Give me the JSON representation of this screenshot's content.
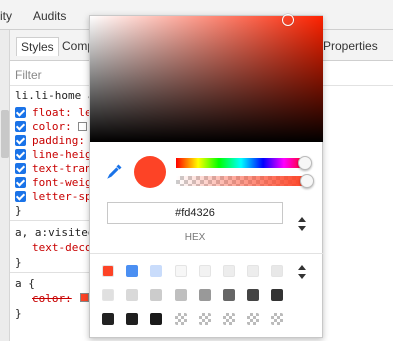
{
  "topbar": {
    "tab_prev": "ity",
    "tab_audits": "Audits"
  },
  "subtabs": {
    "styles": "Styles",
    "computed": "Comp",
    "properties": "Properties"
  },
  "filter": {
    "placeholder": "Filter"
  },
  "rules": [
    {
      "selector": "li.li-home a",
      "props": [
        "float: le",
        "color: ",
        "padding:",
        "line-heig",
        "text-tran",
        "font-weig",
        "letter-sp"
      ]
    },
    {
      "selector": "a, a:visited",
      "props": [
        "text-deco"
      ]
    },
    {
      "selector": "a {",
      "props": [
        "color: "
      ]
    }
  ],
  "brace_close": "}",
  "picker": {
    "current_hex": "#fd4326",
    "format_label": "HEX",
    "colors": {
      "current": "#fd4326",
      "hue": "#fd2200"
    },
    "palette_row1": [
      "#fd4326",
      "#4b8ff2",
      "#c9dcfb",
      "#f7f7f7",
      "#f2f2f2",
      "#ededed",
      "#ededed",
      "#e8e8e8"
    ],
    "palette_row2": [
      "#e0e0e0",
      "#d9d9d9",
      "#cccccc",
      "#bfbfbf",
      "#999999",
      "#666666",
      "#444444",
      "#333333"
    ],
    "palette_row3": [
      "#222222",
      "#1f1f1f",
      "#1a1a1a",
      "check",
      "check",
      "check",
      "check",
      "check"
    ]
  }
}
